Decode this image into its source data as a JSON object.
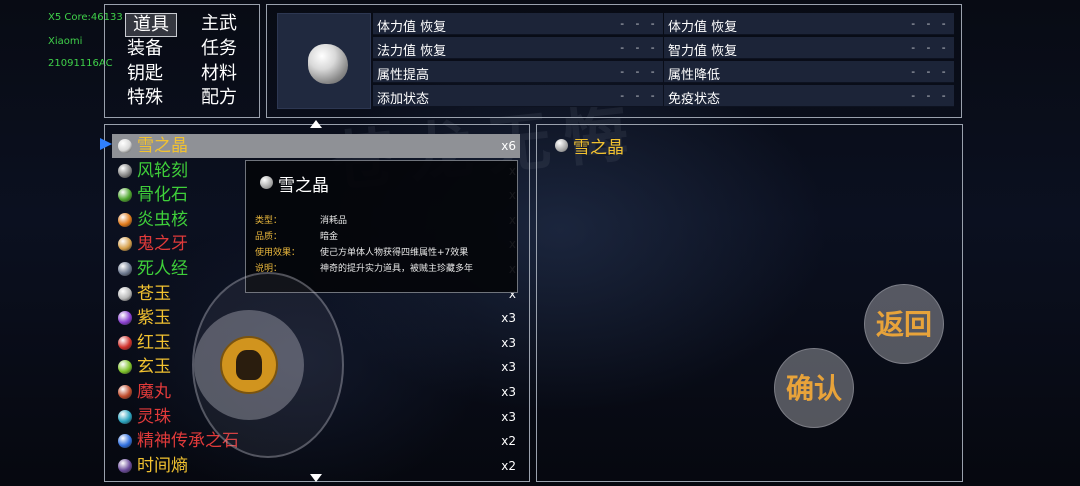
{
  "debug": {
    "line1": "X5 Core:46133",
    "line2": "Xiaomi",
    "line3": "21091116AC"
  },
  "categories": [
    "道具",
    "主武",
    "装备",
    "任务",
    "钥匙",
    "材料",
    "特殊",
    "配方"
  ],
  "selected_category": "道具",
  "stats": [
    {
      "label": "体力值 恢复",
      "value": "- - -"
    },
    {
      "label": "体力值 恢复",
      "value": "- - -"
    },
    {
      "label": "法力值 恢复",
      "value": "- - -"
    },
    {
      "label": "智力值 恢复",
      "value": "- - -"
    },
    {
      "label": "属性提高",
      "value": "- - -"
    },
    {
      "label": "属性降低",
      "value": "- - -"
    },
    {
      "label": "添加状态",
      "value": "- - -"
    },
    {
      "label": "免疫状态",
      "value": "- - -"
    }
  ],
  "items": [
    {
      "name": "雪之晶",
      "qty": "x6",
      "color": "#f2c230",
      "icon_color": "#d8d8d8",
      "icon": "snow-crystal-icon"
    },
    {
      "name": "风轮刻",
      "qty": "x",
      "color": "#3fcf3a",
      "icon_color": "#888888",
      "icon": "wind-wheel-icon"
    },
    {
      "name": "骨化石",
      "qty": "x",
      "color": "#3fcf3a",
      "icon_color": "#4fa82f",
      "icon": "bone-fossil-icon"
    },
    {
      "name": "炎虫核",
      "qty": "x",
      "color": "#3fcf3a",
      "icon_color": "#e07a1a",
      "icon": "fire-bug-core-icon"
    },
    {
      "name": "鬼之牙",
      "qty": "x",
      "color": "#e03a3a",
      "icon_color": "#d6a04a",
      "icon": "ghost-fang-icon"
    },
    {
      "name": "死人经",
      "qty": "x",
      "color": "#3fcf3a",
      "icon_color": "#6e7a90",
      "icon": "scripture-book-icon"
    },
    {
      "name": "苍玉",
      "qty": "x",
      "color": "#f2c230",
      "icon_color": "#b8b8b8",
      "icon": "gray-jade-icon"
    },
    {
      "name": "紫玉",
      "qty": "x3",
      "color": "#f2c230",
      "icon_color": "#8a3fd0",
      "icon": "purple-jade-icon"
    },
    {
      "name": "红玉",
      "qty": "x3",
      "color": "#f2c230",
      "icon_color": "#d0302a",
      "icon": "red-jade-icon"
    },
    {
      "name": "玄玉",
      "qty": "x3",
      "color": "#f2c230",
      "icon_color": "#7fc42a",
      "icon": "dark-jade-icon"
    },
    {
      "name": "魔丸",
      "qty": "x3",
      "color": "#e03a3a",
      "icon_color": "#c04a2a",
      "icon": "demon-pill-icon"
    },
    {
      "name": "灵珠",
      "qty": "x3",
      "color": "#e03a3a",
      "icon_color": "#2aa4c0",
      "icon": "spirit-pearl-icon"
    },
    {
      "name": "精神传承之石",
      "qty": "x2",
      "color": "#e03a3a",
      "icon_color": "#2f6fe0",
      "icon": "spirit-stone-icon"
    },
    {
      "name": "时间熵",
      "qty": "x2",
      "color": "#f2c230",
      "icon_color": "#6a4a9a",
      "icon": "time-entropy-icon"
    }
  ],
  "tooltip": {
    "title": "雪之晶",
    "rows": [
      {
        "label": "类型：",
        "value": "消耗品"
      },
      {
        "label": "品质：",
        "value": "暗金"
      },
      {
        "label": "使用效果：",
        "value": "使己方单体人物获得四维属性+7效果"
      },
      {
        "label": "说明：",
        "value": "神奇的提升实力道具，被贼主珍藏多年"
      }
    ]
  },
  "detail": {
    "name": "雪之晶"
  },
  "buttons": {
    "back": "返回",
    "confirm": "确认"
  },
  "background_text": "苍龙无悔"
}
